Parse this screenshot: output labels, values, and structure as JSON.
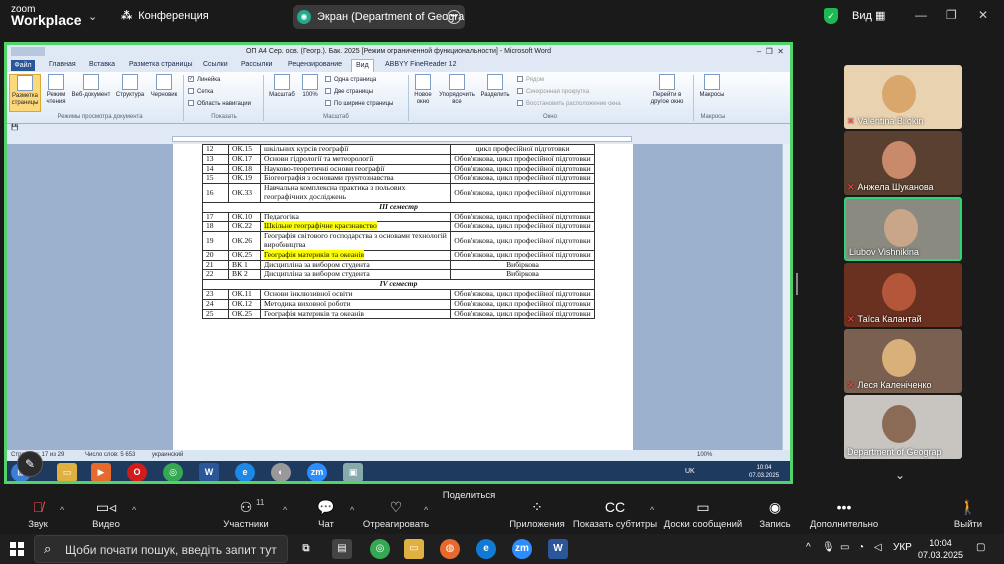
{
  "zoom": {
    "logo_small": "zoom",
    "logo_big": "Workplace",
    "meeting_icon": "people-icon",
    "meeting_title": "Конференция",
    "screen_label": "Экран (Department of Geograph",
    "view_label": "Вид"
  },
  "word": {
    "title": "ОП А4 Сер. осв. (Геогр.). Бак. 2025 [Режим ограниченной функциональности] - Microsoft Word",
    "tabs": [
      "Файл",
      "Главная",
      "Вставка",
      "Разметка страницы",
      "Ссылки",
      "Рассылки",
      "Рецензирование",
      "Вид",
      "ABBYY FineReader 12"
    ],
    "ribbon": {
      "layout": [
        "Разметка страницы",
        "Режим чтения",
        "Веб-документ",
        "Структура",
        "Черновик"
      ],
      "group_views": "Режимы просмотра документа",
      "show": [
        "Линейка",
        "Сетка",
        "Область навигации"
      ],
      "group_show": "Показать",
      "zoom_btns": [
        "Масштаб",
        "100%"
      ],
      "zoom_opts": [
        "Одна страница",
        "Две страницы",
        "По ширине страницы"
      ],
      "group_zoom": "Масштаб",
      "window_btns": [
        "Новое окно",
        "Упорядочить все",
        "Разделить"
      ],
      "window_opts": [
        "Рядом",
        "Синхронная прокрутка",
        "Восстановить расположение окна"
      ],
      "switch": "Перейти в другое окно",
      "group_window": "Окно",
      "macros": "Макросы",
      "group_macros": "Макросы"
    },
    "status": {
      "page": "Страница: 17 из 29",
      "words": "Число слов: 5 653",
      "lang": "украинский",
      "zoom": "100%"
    },
    "rows": [
      {
        "n": "12",
        "code": "ОК.15",
        "title": "шкільних курсів географії",
        "type": "цикл професійної підготовки"
      },
      {
        "n": "13",
        "code": "ОК.17",
        "title": "Основи гідрології та метеорології",
        "type": "Обов'язкова, цикл професійної підготовки"
      },
      {
        "n": "14",
        "code": "ОК.18",
        "title": "Науково-теоретичні основи географії",
        "type": "Обов'язкова, цикл професійної підготовки"
      },
      {
        "n": "15",
        "code": "ОК.19",
        "title": "Біогеографія з основами ґрунтознавства",
        "type": "Обов'язкова, цикл професійної підготовки"
      },
      {
        "n": "16",
        "code": "ОК.33",
        "title": "Навчальна комплексна практика з польових географічних досліджень",
        "type": "Обов'язкова, цикл професійної підготовки"
      },
      {
        "sem": "III семестр"
      },
      {
        "n": "17",
        "code": "ОК.10",
        "title": "Педагогіка",
        "type": "Обов'язкова, цикл професійної підготовки"
      },
      {
        "n": "18",
        "code": "ОК.22",
        "title": "Шкільне географічне краєзнавство",
        "type": "Обов'язкова, цикл професійної підготовки",
        "hl": true
      },
      {
        "n": "19",
        "code": "ОК.26",
        "title": "Географія світового господарства з основами технологій виробництва",
        "type": "Обов'язкова, цикл професійної підготовки"
      },
      {
        "n": "20",
        "code": "ОК.25",
        "title": "Географія материків та океанів",
        "type": "Обов'язкова, цикл професійної підготовки",
        "hl": true
      },
      {
        "n": "21",
        "code": "ВК 1",
        "title": "Дисципліна за вибором студента",
        "type": "Вибіркова"
      },
      {
        "n": "22",
        "code": "ВК 2",
        "title": "Дисципліна за вибором студента",
        "type": "Вибіркова"
      },
      {
        "sem": "IV семестр"
      },
      {
        "n": "23",
        "code": "ОК.11",
        "title": "Основи інклюзивної освіти",
        "type": "Обов'язкова, цикл професійної підготовки"
      },
      {
        "n": "24",
        "code": "ОК.12",
        "title": "Методика виховної роботи",
        "type": "Обов'язкова, цикл професійної підготовки"
      },
      {
        "n": "25",
        "code": "ОК.25",
        "title": "Географія материків та океанів",
        "type": "Обов'язкова, цикл професійної підготовки"
      }
    ],
    "taskbar_clock": [
      "10:04",
      "07.03.2025"
    ],
    "taskbar_lang": "UK"
  },
  "participants": [
    {
      "name": "Valentina Bilokin",
      "muted": true
    },
    {
      "name": "Анжела Шуканова",
      "muted": true
    },
    {
      "name": "Liubov Vishnikina",
      "muted": false,
      "active": true
    },
    {
      "name": "Таїса Калантай",
      "muted": true
    },
    {
      "name": "Леся Каленіченко",
      "muted": true
    },
    {
      "name": "Department of Geograp",
      "muted": false
    }
  ],
  "toolbar": [
    {
      "label": "Звук",
      "icon": "mic-muted-icon"
    },
    {
      "label": "Видео",
      "icon": "camera-icon"
    },
    {
      "label": "Участники",
      "icon": "participants-icon",
      "count": "11"
    },
    {
      "label": "Чат",
      "icon": "chat-icon"
    },
    {
      "label": "Отреагировать",
      "icon": "heart-icon"
    },
    {
      "label": "Поделиться",
      "icon": "share-icon"
    },
    {
      "label": "Приложения",
      "icon": "apps-icon"
    },
    {
      "label": "Показать субтитры",
      "icon": "cc-icon"
    },
    {
      "label": "Доски сообщений",
      "icon": "whiteboard-icon"
    },
    {
      "label": "Запись",
      "icon": "record-icon"
    },
    {
      "label": "Дополнительно",
      "icon": "more-icon"
    },
    {
      "label": "Выйти",
      "icon": "leave-icon"
    }
  ],
  "taskbar": {
    "search_placeholder": "Щоби почати пошук, введіть запит тут",
    "lang": "УКР",
    "time": "10:04",
    "date": "07.03.2025"
  },
  "colors": {
    "zoom_green": "#1db954",
    "active_border": "#2ed573",
    "word_blue": "#2b579a",
    "highlight": "#ffff00"
  }
}
